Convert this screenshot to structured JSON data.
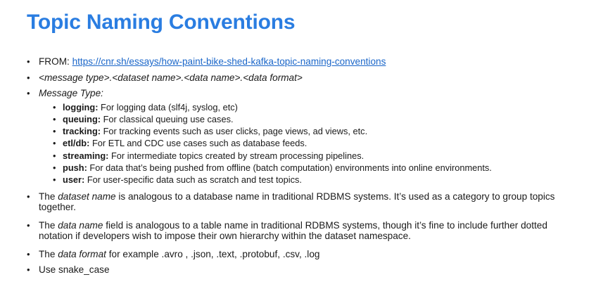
{
  "slide": {
    "title": "Topic Naming Conventions",
    "from": {
      "label": "FROM: ",
      "url": "https://cnr.sh/essays/how-paint-bike-shed-kafka-topic-naming-conventions"
    },
    "pattern": "<message type>.<dataset name>.<data name>.<data format>",
    "message_type": {
      "heading": "Message Type:",
      "items": [
        {
          "term": "logging:",
          "desc": " For logging data (slf4j, syslog, etc)"
        },
        {
          "term": "queuing:",
          "desc": " For classical queuing use cases."
        },
        {
          "term": "tracking:",
          "desc": " For tracking events such as user clicks, page views, ad views, etc."
        },
        {
          "term": "etl/db:",
          "desc": " For ETL and CDC use cases such as database feeds."
        },
        {
          "term": "streaming:",
          "desc": " For intermediate topics created by stream processing pipelines."
        },
        {
          "term": "push:",
          "desc": " For data that’s being pushed from offline (batch computation) environments into online environments."
        },
        {
          "term": "user:",
          "desc": " For user-specific data such as scratch and test topics."
        }
      ]
    },
    "dataset_name": {
      "pre": "The ",
      "em": "dataset name",
      "post": " is analogous to a database name in traditional RDBMS systems. It’s used as a category to group topics together."
    },
    "data_name": {
      "pre": "The ",
      "em": "data name",
      "post": " field is analogous to a table name in traditional RDBMS systems, though it’s fine to include further dotted notation if developers wish to impose their own hierarchy within the dataset namespace."
    },
    "data_format": {
      "pre": "The ",
      "em": "data format",
      "post": " for example .avro , .json, .text, .protobuf, .csv, .log"
    },
    "snake_case": "Use snake_case"
  }
}
